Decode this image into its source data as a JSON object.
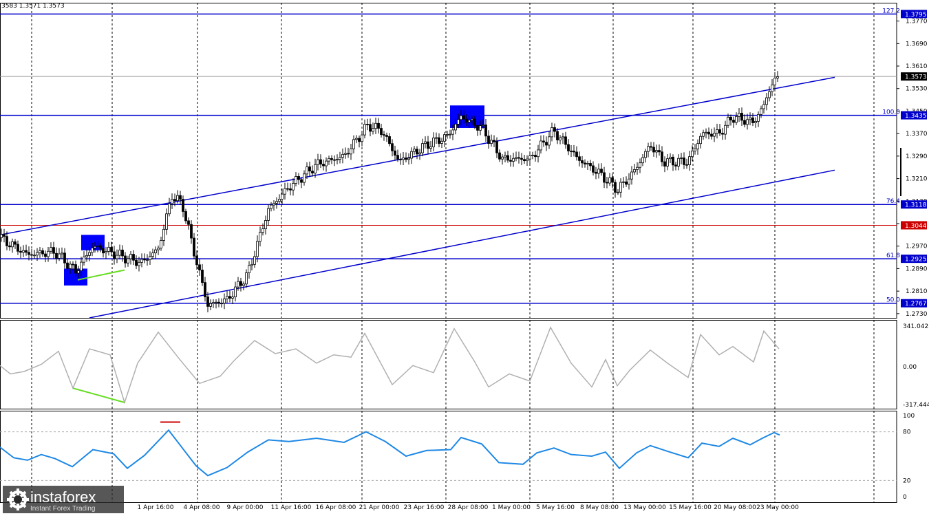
{
  "header": {
    "ohlc_text": "3583 1.3571 1.3573"
  },
  "branding": {
    "name": "instaforex",
    "tagline": "Instant Forex Trading"
  },
  "colors": {
    "candle": "#000000",
    "level": "#0000cc",
    "channel": "#0000cc",
    "red_line": "#cc0000",
    "highlight_box": "#0000ff",
    "divergence": "#66dd22",
    "cci_line": "#b0b0b0",
    "rsi_line": "#1e88e5",
    "price_tag_bg": "#0000cc"
  },
  "chart_data": [
    {
      "type": "candlestick",
      "title": "",
      "ylim": [
        1.2715,
        1.3835
      ],
      "price_ticks": [
        "1.3770",
        "1.3690",
        "1.3610",
        "1.3530",
        "1.3450",
        "1.3370",
        "1.3290",
        "1.3210",
        "1.3130",
        "1.3050",
        "1.2970",
        "1.2890",
        "1.2810",
        "1.2730"
      ],
      "x_labels": [
        "1 Apr 16:00",
        "4 Apr 08:00",
        "9 Apr 00:00",
        "11 Apr 16:00",
        "16 Apr 08:00",
        "21 Apr 00:00",
        "23 Apr 16:00",
        "28 Apr 08:00",
        "1 May 00:00",
        "5 May 16:00",
        "8 May 08:00",
        "13 May 00:00",
        "15 May 16:00",
        "20 May 08:00",
        "23 May 00:00"
      ],
      "horizontal_levels": [
        {
          "fib": "127.2",
          "price": "1.3795"
        },
        {
          "fib": "100.0",
          "price": "1.3435"
        },
        {
          "fib": "76.4",
          "price": "1.3118"
        },
        {
          "fib": "",
          "price": "1.3044"
        },
        {
          "fib": "61.8",
          "price": "1.2925"
        },
        {
          "fib": "50.0",
          "price": "1.2767"
        }
      ],
      "current_price": "1.3573",
      "close_path": [
        {
          "x": 0,
          "y": 1.3
        },
        {
          "x": 40,
          "y": 1.294
        },
        {
          "x": 80,
          "y": 1.295
        },
        {
          "x": 110,
          "y": 1.288
        },
        {
          "x": 135,
          "y": 1.297
        },
        {
          "x": 170,
          "y": 1.294
        },
        {
          "x": 205,
          "y": 1.291
        },
        {
          "x": 230,
          "y": 1.296
        },
        {
          "x": 250,
          "y": 1.315
        },
        {
          "x": 265,
          "y": 1.312
        },
        {
          "x": 285,
          "y": 1.292
        },
        {
          "x": 302,
          "y": 1.276
        },
        {
          "x": 330,
          "y": 1.278
        },
        {
          "x": 360,
          "y": 1.287
        },
        {
          "x": 390,
          "y": 1.31
        },
        {
          "x": 420,
          "y": 1.318
        },
        {
          "x": 460,
          "y": 1.326
        },
        {
          "x": 500,
          "y": 1.329
        },
        {
          "x": 535,
          "y": 1.34
        },
        {
          "x": 555,
          "y": 1.338
        },
        {
          "x": 580,
          "y": 1.327
        },
        {
          "x": 620,
          "y": 1.333
        },
        {
          "x": 650,
          "y": 1.336
        },
        {
          "x": 670,
          "y": 1.343
        },
        {
          "x": 700,
          "y": 1.339
        },
        {
          "x": 730,
          "y": 1.328
        },
        {
          "x": 770,
          "y": 1.328
        },
        {
          "x": 805,
          "y": 1.338
        },
        {
          "x": 840,
          "y": 1.328
        },
        {
          "x": 870,
          "y": 1.323
        },
        {
          "x": 898,
          "y": 1.317
        },
        {
          "x": 920,
          "y": 1.323
        },
        {
          "x": 945,
          "y": 1.333
        },
        {
          "x": 965,
          "y": 1.327
        },
        {
          "x": 1000,
          "y": 1.327
        },
        {
          "x": 1020,
          "y": 1.337
        },
        {
          "x": 1045,
          "y": 1.337
        },
        {
          "x": 1065,
          "y": 1.343
        },
        {
          "x": 1095,
          "y": 1.341
        },
        {
          "x": 1110,
          "y": 1.347
        },
        {
          "x": 1120,
          "y": 1.354
        },
        {
          "x": 1132,
          "y": 1.3573
        }
      ],
      "channel_lines": [
        {
          "x1": 0,
          "y1": 1.301,
          "x2": 1213,
          "y2": 1.357
        },
        {
          "x1": 130,
          "y1": 1.2715,
          "x2": 1213,
          "y2": 1.324
        }
      ],
      "highlight_boxes": [
        {
          "x": 118,
          "top": 1.301,
          "bottom": 1.2955
        },
        {
          "x": 93,
          "top": 1.289,
          "bottom": 1.283
        },
        {
          "x": 654,
          "top": 1.347,
          "bottom": 1.339
        }
      ],
      "divergence_line": {
        "x1": 113,
        "y1": 1.285,
        "x2": 181,
        "y2": 1.2885
      }
    },
    {
      "type": "line",
      "title": "",
      "name": "cci_panel",
      "ylim": [
        -317.444,
        341.0423
      ],
      "tick_labels": [
        "341.0423",
        "0.00",
        "-317.444"
      ],
      "points": [
        {
          "x": 0,
          "y": 10
        },
        {
          "x": 15,
          "y": -60
        },
        {
          "x": 35,
          "y": -40
        },
        {
          "x": 60,
          "y": 20
        },
        {
          "x": 85,
          "y": 130
        },
        {
          "x": 106,
          "y": -180
        },
        {
          "x": 130,
          "y": 150
        },
        {
          "x": 160,
          "y": 100
        },
        {
          "x": 181,
          "y": -300
        },
        {
          "x": 200,
          "y": 30
        },
        {
          "x": 230,
          "y": 290
        },
        {
          "x": 260,
          "y": 70
        },
        {
          "x": 290,
          "y": -140
        },
        {
          "x": 320,
          "y": -80
        },
        {
          "x": 340,
          "y": 50
        },
        {
          "x": 370,
          "y": 220
        },
        {
          "x": 400,
          "y": 110
        },
        {
          "x": 430,
          "y": 150
        },
        {
          "x": 460,
          "y": 30
        },
        {
          "x": 485,
          "y": 100
        },
        {
          "x": 510,
          "y": 80
        },
        {
          "x": 530,
          "y": 280
        },
        {
          "x": 570,
          "y": -150
        },
        {
          "x": 600,
          "y": 10
        },
        {
          "x": 630,
          "y": -50
        },
        {
          "x": 660,
          "y": 320
        },
        {
          "x": 690,
          "y": 40
        },
        {
          "x": 710,
          "y": -170
        },
        {
          "x": 740,
          "y": -60
        },
        {
          "x": 770,
          "y": -120
        },
        {
          "x": 800,
          "y": 330
        },
        {
          "x": 830,
          "y": 30
        },
        {
          "x": 860,
          "y": -170
        },
        {
          "x": 880,
          "y": 60
        },
        {
          "x": 897,
          "y": -160
        },
        {
          "x": 915,
          "y": -30
        },
        {
          "x": 945,
          "y": 140
        },
        {
          "x": 970,
          "y": 30
        },
        {
          "x": 1000,
          "y": -90
        },
        {
          "x": 1018,
          "y": 270
        },
        {
          "x": 1045,
          "y": 100
        },
        {
          "x": 1065,
          "y": 170
        },
        {
          "x": 1095,
          "y": 40
        },
        {
          "x": 1110,
          "y": 300
        },
        {
          "x": 1132,
          "y": 150
        }
      ],
      "divergence_line": {
        "x1": 106,
        "y1": -180,
        "x2": 181,
        "y2": -300
      }
    },
    {
      "type": "line",
      "title": "",
      "name": "rsi_panel",
      "ylim": [
        0,
        100
      ],
      "tick_labels": [
        "100",
        "80",
        "20",
        "0"
      ],
      "levels": [
        80,
        20
      ],
      "points": [
        {
          "x": 0,
          "y": 61
        },
        {
          "x": 20,
          "y": 48
        },
        {
          "x": 40,
          "y": 45
        },
        {
          "x": 60,
          "y": 52
        },
        {
          "x": 80,
          "y": 47
        },
        {
          "x": 105,
          "y": 37
        },
        {
          "x": 135,
          "y": 58
        },
        {
          "x": 165,
          "y": 53
        },
        {
          "x": 185,
          "y": 35
        },
        {
          "x": 210,
          "y": 51
        },
        {
          "x": 245,
          "y": 82
        },
        {
          "x": 265,
          "y": 60
        },
        {
          "x": 285,
          "y": 38
        },
        {
          "x": 302,
          "y": 26
        },
        {
          "x": 330,
          "y": 36
        },
        {
          "x": 360,
          "y": 55
        },
        {
          "x": 390,
          "y": 70
        },
        {
          "x": 420,
          "y": 68
        },
        {
          "x": 460,
          "y": 72
        },
        {
          "x": 500,
          "y": 67
        },
        {
          "x": 532,
          "y": 80
        },
        {
          "x": 560,
          "y": 68
        },
        {
          "x": 590,
          "y": 50
        },
        {
          "x": 620,
          "y": 57
        },
        {
          "x": 655,
          "y": 58
        },
        {
          "x": 670,
          "y": 73
        },
        {
          "x": 700,
          "y": 65
        },
        {
          "x": 725,
          "y": 42
        },
        {
          "x": 760,
          "y": 40
        },
        {
          "x": 780,
          "y": 54
        },
        {
          "x": 805,
          "y": 60
        },
        {
          "x": 830,
          "y": 52
        },
        {
          "x": 860,
          "y": 50
        },
        {
          "x": 880,
          "y": 55
        },
        {
          "x": 900,
          "y": 35
        },
        {
          "x": 925,
          "y": 54
        },
        {
          "x": 945,
          "y": 63
        },
        {
          "x": 970,
          "y": 56
        },
        {
          "x": 1000,
          "y": 48
        },
        {
          "x": 1020,
          "y": 66
        },
        {
          "x": 1045,
          "y": 62
        },
        {
          "x": 1065,
          "y": 72
        },
        {
          "x": 1090,
          "y": 64
        },
        {
          "x": 1110,
          "y": 73
        },
        {
          "x": 1125,
          "y": 79
        },
        {
          "x": 1133,
          "y": 76
        }
      ],
      "marker": {
        "x1": 233,
        "x2": 262,
        "value": 92
      }
    }
  ]
}
